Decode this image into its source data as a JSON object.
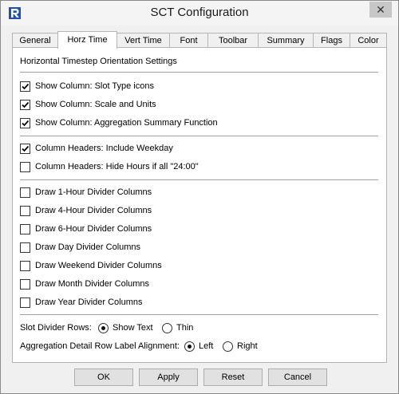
{
  "window": {
    "title": "SCT Configuration",
    "close_glyph": "✕",
    "app_icon": "riverware-r-logo-icon"
  },
  "tabs": [
    {
      "label": "General",
      "active": false
    },
    {
      "label": "Horz Time",
      "active": true
    },
    {
      "label": "Vert Time",
      "active": false
    },
    {
      "label": "Font",
      "active": false
    },
    {
      "label": "Toolbar",
      "active": false
    },
    {
      "label": "Summary",
      "active": false
    },
    {
      "label": "Flags",
      "active": false
    },
    {
      "label": "Color",
      "active": false
    }
  ],
  "panel": {
    "heading": "Horizontal Timestep Orientation Settings",
    "group1": [
      {
        "label": "Show Column: Slot Type icons",
        "checked": true
      },
      {
        "label": "Show Column: Scale and Units",
        "checked": true
      },
      {
        "label": "Show Column: Aggregation Summary Function",
        "checked": true
      }
    ],
    "group2": [
      {
        "label": "Column Headers: Include Weekday",
        "checked": true
      },
      {
        "label": "Column Headers: Hide Hours if all \"24:00\"",
        "checked": false
      }
    ],
    "group3": [
      {
        "label": "Draw 1-Hour Divider Columns",
        "checked": false
      },
      {
        "label": "Draw 4-Hour Divider Columns",
        "checked": false
      },
      {
        "label": "Draw 6-Hour Divider Columns",
        "checked": false
      },
      {
        "label": "Draw Day Divider Columns",
        "checked": false
      },
      {
        "label": "Draw Weekend Divider Columns",
        "checked": false
      },
      {
        "label": "Draw Month Divider Columns",
        "checked": false
      },
      {
        "label": "Draw Year Divider Columns",
        "checked": false
      }
    ],
    "slot_divider": {
      "label": "Slot Divider Rows:",
      "options": [
        {
          "label": "Show Text",
          "selected": true
        },
        {
          "label": "Thin",
          "selected": false
        }
      ]
    },
    "aggregation_alignment": {
      "label": "Aggregation Detail Row Label Alignment:",
      "options": [
        {
          "label": "Left",
          "selected": true
        },
        {
          "label": "Right",
          "selected": false
        }
      ]
    }
  },
  "buttons": {
    "ok": "OK",
    "apply": "Apply",
    "reset": "Reset",
    "cancel": "Cancel"
  },
  "colors": {
    "logo_blue": "#1f4fb0",
    "window_bg": "#f0f0f0",
    "panel_bg": "#ffffff"
  }
}
